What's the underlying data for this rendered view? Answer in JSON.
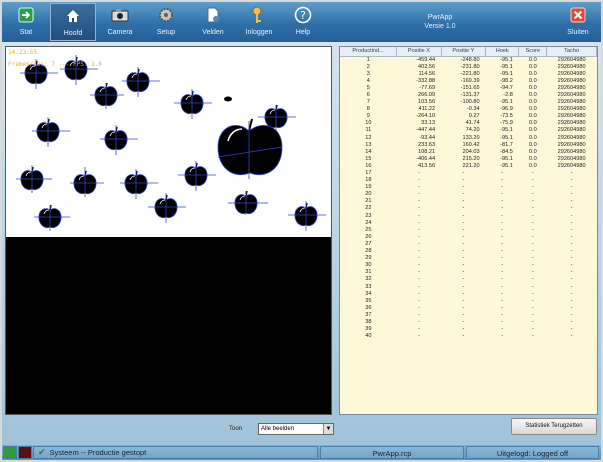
{
  "toolbar": {
    "buttons": [
      {
        "label": "Stat",
        "icon": "exit-arrow-icon"
      },
      {
        "label": "Hoofd",
        "icon": "home-icon"
      },
      {
        "label": "Camera",
        "icon": "camera-icon"
      },
      {
        "label": "Setup",
        "icon": "gear-icon"
      },
      {
        "label": "Velden",
        "icon": "document-icon"
      },
      {
        "label": "Inloggen",
        "icon": "keys-icon"
      },
      {
        "label": "Help",
        "icon": "question-icon"
      }
    ],
    "close_label": "Sluiten",
    "app_name": "PwrApp",
    "app_version": "Versie 1.0"
  },
  "camera": {
    "timestamp": "14:23:55",
    "fps_text": "Frames/sec: 7  ---  FPS: 1.0"
  },
  "table": {
    "headers": [
      "Productind...",
      "Positie X",
      "Positie Y",
      "Hoek",
      "Score",
      "Tacho"
    ],
    "rows": [
      [
        "1",
        "-459.44",
        "-248.80",
        "-95.1",
        "0.0",
        "292604980"
      ],
      [
        "2",
        "402.56",
        "-231.80",
        "-95.1",
        "0.0",
        "292604980"
      ],
      [
        "3",
        "114.56",
        "-221.80",
        "-95.1",
        "0.0",
        "292604980"
      ],
      [
        "4",
        "-332.88",
        "-169.39",
        "-98.2",
        "0.0",
        "292604980"
      ],
      [
        "5",
        "-77.69",
        "-151.65",
        "-94.7",
        "0.0",
        "292604980"
      ],
      [
        "6",
        "266.09",
        "-131.37",
        "-2.8",
        "0.0",
        "292604980"
      ],
      [
        "7",
        "103.56",
        "-100.80",
        "-95.1",
        "0.0",
        "292604980"
      ],
      [
        "8",
        "411.22",
        "-0.34",
        "-96.9",
        "0.0",
        "292604980"
      ],
      [
        "9",
        "-264.10",
        "0.27",
        "-73.5",
        "0.0",
        "292604980"
      ],
      [
        "10",
        "33.13",
        "41.74",
        "-75.9",
        "0.0",
        "292604980"
      ],
      [
        "11",
        "-447.44",
        "74.20",
        "-95.1",
        "0.0",
        "292604980"
      ],
      [
        "12",
        "-93.44",
        "133.20",
        "-95.1",
        "0.0",
        "292604980"
      ],
      [
        "13",
        "233.63",
        "160.42",
        "-81.7",
        "0.0",
        "292604980"
      ],
      [
        "14",
        "108.21",
        "204.03",
        "-84.5",
        "0.0",
        "292604980"
      ],
      [
        "15",
        "-406.44",
        "215.20",
        "-95.1",
        "0.0",
        "292604980"
      ],
      [
        "16",
        "413.56",
        "221.20",
        "-95.1",
        "0.0",
        "292604980"
      ],
      [
        "17",
        "-",
        "-",
        "-",
        "-",
        "-"
      ],
      [
        "18",
        "-",
        "-",
        "-",
        "-",
        "-"
      ],
      [
        "19",
        "-",
        "-",
        "-",
        "-",
        "-"
      ],
      [
        "20",
        "-",
        "-",
        "-",
        "-",
        "-"
      ],
      [
        "21",
        "-",
        "-",
        "-",
        "-",
        "-"
      ],
      [
        "22",
        "-",
        "-",
        "-",
        "-",
        "-"
      ],
      [
        "23",
        "-",
        "-",
        "-",
        "-",
        "-"
      ],
      [
        "24",
        "-",
        "-",
        "-",
        "-",
        "-"
      ],
      [
        "25",
        "-",
        "-",
        "-",
        "-",
        "-"
      ],
      [
        "26",
        "-",
        "-",
        "-",
        "-",
        "-"
      ],
      [
        "27",
        "-",
        "-",
        "-",
        "-",
        "-"
      ],
      [
        "28",
        "-",
        "-",
        "-",
        "-",
        "-"
      ],
      [
        "29",
        "-",
        "-",
        "-",
        "-",
        "-"
      ],
      [
        "30",
        "-",
        "-",
        "-",
        "-",
        "-"
      ],
      [
        "31",
        "-",
        "-",
        "-",
        "-",
        "-"
      ],
      [
        "32",
        "-",
        "-",
        "-",
        "-",
        "-"
      ],
      [
        "33",
        "-",
        "-",
        "-",
        "-",
        "-"
      ],
      [
        "34",
        "-",
        "-",
        "-",
        "-",
        "-"
      ],
      [
        "35",
        "-",
        "-",
        "-",
        "-",
        "-"
      ],
      [
        "36",
        "-",
        "-",
        "-",
        "-",
        "-"
      ],
      [
        "37",
        "-",
        "-",
        "-",
        "-",
        "-"
      ],
      [
        "38",
        "-",
        "-",
        "-",
        "-",
        "-"
      ],
      [
        "39",
        "-",
        "-",
        "-",
        "-",
        "-"
      ],
      [
        "40",
        "-",
        "-",
        "-",
        "-",
        "-"
      ]
    ]
  },
  "view_select": {
    "label": "Toon",
    "selected": "Alle beelden"
  },
  "stat_reset_label": "Statistiek Terugzetten",
  "status": {
    "text": "Systeem -- Productie gestopt",
    "file": "PwrApp.rcp",
    "login": "Uitgelogd: Logged off"
  },
  "colors": {
    "toolbar": "#2f6fa8",
    "table_bg": "#fff8d8",
    "overlay_text": "#f7a928",
    "axis_lines": "#3344cc",
    "close_button": "#e0483a"
  }
}
